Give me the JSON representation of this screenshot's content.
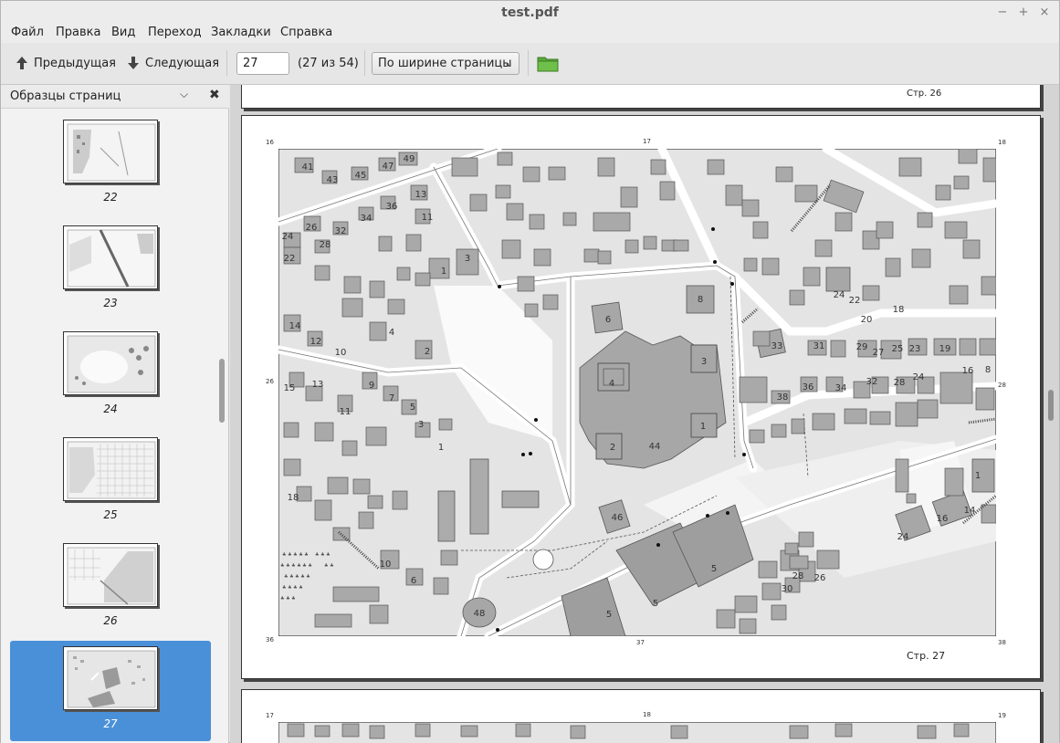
{
  "window": {
    "title": "test.pdf",
    "controls": {
      "minimize": "−",
      "maximize": "+",
      "close": "×"
    }
  },
  "menu": [
    "Файл",
    "Правка",
    "Вид",
    "Переход",
    "Закладки",
    "Справка"
  ],
  "toolbar": {
    "prev_label": "Предыдущая",
    "next_label": "Следующая",
    "page_value": "27",
    "page_count": "(27 из 54)",
    "zoom_selected": "По ширине страницы"
  },
  "sidebar": {
    "title": "Образцы страниц",
    "thumbnails": [
      {
        "label": "22",
        "selected": false
      },
      {
        "label": "23",
        "selected": false
      },
      {
        "label": "24",
        "selected": false
      },
      {
        "label": "25",
        "selected": false
      },
      {
        "label": "26",
        "selected": false
      },
      {
        "label": "27",
        "selected": true
      }
    ]
  },
  "document": {
    "prev_page_footer": "Стр. 26",
    "current_page": {
      "footer": "Стр. 27",
      "corners": {
        "top_left": "16",
        "top_mid": "17",
        "top_right": "18",
        "bottom_left": "36",
        "bottom_mid": "37",
        "bottom_right": "38",
        "mid_left": "26",
        "mid_right": "28"
      },
      "building_numbers": [
        "41",
        "43",
        "45",
        "47",
        "49",
        "13",
        "11",
        "36",
        "34",
        "32",
        "26",
        "28",
        "24",
        "22",
        "3",
        "1",
        "14",
        "12",
        "10",
        "4",
        "2",
        "13",
        "15",
        "9",
        "7",
        "5",
        "3",
        "11",
        "1",
        "18",
        "10",
        "6",
        "48",
        "6",
        "8",
        "3",
        "4",
        "44",
        "2",
        "1",
        "46",
        "5",
        "5",
        "5",
        "33",
        "31",
        "29",
        "27",
        "25",
        "23",
        "19",
        "38",
        "36",
        "34",
        "32",
        "28",
        "24",
        "16",
        "8",
        "18",
        "20",
        "24",
        "22",
        "1",
        "14",
        "16",
        "24",
        "28",
        "26",
        "30"
      ]
    },
    "next_page": {
      "corners": {
        "top_left": "17",
        "top_mid": "18",
        "top_right": "19"
      }
    }
  },
  "colors": {
    "selection": "#4a90d9",
    "folder_icon": "#5aa83a"
  }
}
